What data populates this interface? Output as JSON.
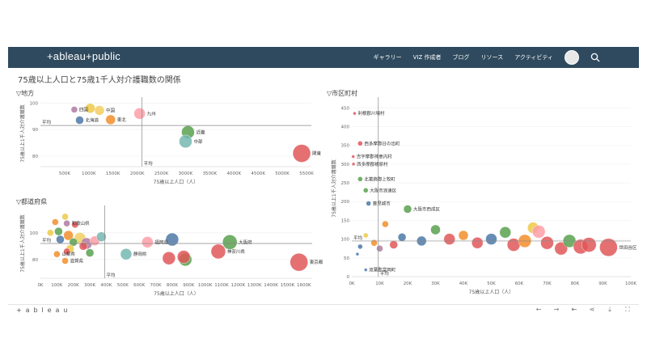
{
  "navbar": {
    "logo": "+ableau+public",
    "links": [
      "ギャラリー",
      "VIZ 作成者",
      "ブログ",
      "リソース",
      "アクティビティ"
    ]
  },
  "dashboard": {
    "title": "75歳以上人口と75歳1千人対介護職数の関係",
    "sheets": {
      "region": "▽地方",
      "prefecture": "▽都道府県",
      "municipality": "▽市区町村"
    }
  },
  "footer": {
    "logo": "+ a b l e a u",
    "controls": [
      "undo-icon",
      "redo-icon",
      "revert-icon",
      "share-icon",
      "download-icon",
      "fullscreen-icon"
    ]
  },
  "chart_data": [
    {
      "type": "scatter",
      "xlabel": "75歳以上人口（人）",
      "ylabel": "75歳以上1千人対介護職数",
      "xlim": [
        0,
        5600000
      ],
      "ylim": [
        76,
        101
      ],
      "xticks": [
        500000,
        1000000,
        1500000,
        2000000,
        2500000,
        3000000,
        3500000,
        4000000,
        4500000,
        5000000,
        5500000
      ],
      "xticklabels": [
        "500K",
        "1000K",
        "1500K",
        "2000K",
        "2500K",
        "3000K",
        "3500K",
        "4000K",
        "4500K",
        "5000K",
        "5500K"
      ],
      "yticks": [
        80,
        90,
        100
      ],
      "reference_lines": {
        "x": 2100000,
        "y": 91.5,
        "x_label": "平均",
        "y_label": "平均"
      },
      "points": [
        {
          "label": "四国",
          "x": 700000,
          "y": 97.5,
          "size": 4,
          "color": "#b07aa1"
        },
        {
          "label": "",
          "x": 1030000,
          "y": 98,
          "size": 6,
          "color": "#edc948"
        },
        {
          "label": "中国",
          "x": 1220000,
          "y": 97.2,
          "size": 6,
          "color": "#f1ce63"
        },
        {
          "label": "北海道",
          "x": 810000,
          "y": 93.5,
          "size": 5,
          "color": "#4e79a7"
        },
        {
          "label": "東北",
          "x": 1450000,
          "y": 93.7,
          "size": 6,
          "color": "#f28e2b"
        },
        {
          "label": "九州",
          "x": 2050000,
          "y": 96,
          "size": 7,
          "color": "#ff9da7"
        },
        {
          "label": "近畿",
          "x": 3050000,
          "y": 89,
          "size": 8,
          "color": "#59a14f"
        },
        {
          "label": "中部",
          "x": 3000000,
          "y": 85.5,
          "size": 8,
          "color": "#76b7b2"
        },
        {
          "label": "関東",
          "x": 5400000,
          "y": 81,
          "size": 11,
          "color": "#e15759"
        }
      ]
    },
    {
      "type": "scatter",
      "xlabel": "75歳以上人口（人）",
      "ylabel": "75歳以上1千人対介護職数",
      "xlim": [
        0,
        1650000
      ],
      "ylim": [
        66,
        118
      ],
      "xticks": [
        0,
        100000,
        200000,
        300000,
        400000,
        500000,
        600000,
        700000,
        800000,
        900000,
        1000000,
        1100000,
        1200000,
        1300000,
        1400000,
        1500000,
        1600000
      ],
      "xticklabels": [
        "0K",
        "100K",
        "200K",
        "300K",
        "400K",
        "500K",
        "600K",
        "700K",
        "800K",
        "900K",
        "1000K",
        "1100K",
        "1200K",
        "1300K",
        "1400K",
        "1500K",
        "1600K"
      ],
      "yticks": [
        80,
        100
      ],
      "reference_lines": {
        "x": 390000,
        "y": 92,
        "x_label": "平均",
        "y_label": "平均"
      },
      "points": [
        {
          "label": "",
          "x": 150000,
          "y": 112,
          "size": 4,
          "color": "#edc948"
        },
        {
          "label": "和歌山県",
          "x": 160000,
          "y": 107,
          "size": 4,
          "color": "#b07aa1"
        },
        {
          "label": "",
          "x": 210000,
          "y": 106,
          "size": 4,
          "color": "#e15759"
        },
        {
          "label": "",
          "x": 90000,
          "y": 108,
          "size": 4,
          "color": "#f28e2b"
        },
        {
          "label": "",
          "x": 60000,
          "y": 100,
          "size": 4,
          "color": "#edc948"
        },
        {
          "label": "",
          "x": 110000,
          "y": 101,
          "size": 5,
          "color": "#59a14f"
        },
        {
          "label": "",
          "x": 170000,
          "y": 98,
          "size": 6,
          "color": "#f28e2b"
        },
        {
          "label": "",
          "x": 240000,
          "y": 96,
          "size": 7,
          "color": "#f1ce63"
        },
        {
          "label": "",
          "x": 280000,
          "y": 92,
          "size": 7,
          "color": "#b07aa1"
        },
        {
          "label": "",
          "x": 330000,
          "y": 94,
          "size": 6,
          "color": "#ff9da7"
        },
        {
          "label": "",
          "x": 200000,
          "y": 93,
          "size": 5,
          "color": "#59a14f"
        },
        {
          "label": "",
          "x": 120000,
          "y": 95,
          "size": 5,
          "color": "#4e79a7"
        },
        {
          "label": "",
          "x": 260000,
          "y": 90,
          "size": 5,
          "color": "#e15759"
        },
        {
          "label": "",
          "x": 180000,
          "y": 88,
          "size": 5,
          "color": "#edc948"
        },
        {
          "label": "山梨県",
          "x": 100000,
          "y": 84,
          "size": 4,
          "color": "#f28e2b"
        },
        {
          "label": "",
          "x": 160000,
          "y": 86,
          "size": 4,
          "color": "#e15759"
        },
        {
          "label": "滋賀県",
          "x": 150000,
          "y": 79,
          "size": 4,
          "color": "#f28e2b"
        },
        {
          "label": "",
          "x": 300000,
          "y": 85,
          "size": 5,
          "color": "#59a14f"
        },
        {
          "label": "",
          "x": 370000,
          "y": 97,
          "size": 6,
          "color": "#76b7b2"
        },
        {
          "label": "福岡県",
          "x": 650000,
          "y": 93,
          "size": 7,
          "color": "#ff9da7"
        },
        {
          "label": "",
          "x": 800000,
          "y": 95,
          "size": 8,
          "color": "#4e79a7"
        },
        {
          "label": "静岡県",
          "x": 520000,
          "y": 84,
          "size": 7,
          "color": "#76b7b2"
        },
        {
          "label": "",
          "x": 780000,
          "y": 81,
          "size": 8,
          "color": "#e15759"
        },
        {
          "label": "",
          "x": 880000,
          "y": 80,
          "size": 8,
          "color": "#59a14f"
        },
        {
          "label": "",
          "x": 870000,
          "y": 82,
          "size": 8,
          "color": "#e15759"
        },
        {
          "label": "神奈川県",
          "x": 1080000,
          "y": 86,
          "size": 9,
          "color": "#e15759"
        },
        {
          "label": "大阪府",
          "x": 1150000,
          "y": 93,
          "size": 9,
          "color": "#59a14f"
        },
        {
          "label": "東京都",
          "x": 1570000,
          "y": 78,
          "size": 11,
          "color": "#e15759"
        }
      ]
    },
    {
      "type": "scatter",
      "xlabel": "75歳以上人口（人）",
      "ylabel": "75歳以上1千人対介護職数",
      "xlim": [
        0,
        100000
      ],
      "ylim": [
        0,
        470
      ],
      "xticks": [
        0,
        10000,
        20000,
        30000,
        40000,
        50000,
        60000,
        70000,
        80000,
        90000,
        100000
      ],
      "xticklabels": [
        "0K",
        "10K",
        "20K",
        "30K",
        "40K",
        "50K",
        "60K",
        "70K",
        "80K",
        "90K",
        "100K"
      ],
      "yticks": [
        0,
        50,
        100,
        150,
        200,
        250,
        300,
        350,
        400,
        450
      ],
      "reference_lines": {
        "x": 9500,
        "y": 95,
        "x_label": "平均",
        "y_label": "平均"
      },
      "points": [
        {
          "label": "利根郡川場村",
          "x": 1000,
          "y": 435,
          "size": 2,
          "color": "#e15759"
        },
        {
          "label": "西多摩郡日の出町",
          "x": 3000,
          "y": 355,
          "size": 3,
          "color": "#e15759"
        },
        {
          "label": "吉宇摩郡神恵内村",
          "x": 500,
          "y": 320,
          "size": 2,
          "color": "#e15759"
        },
        {
          "label": "西多摩郡檜原村",
          "x": 600,
          "y": 300,
          "size": 2,
          "color": "#e15759"
        },
        {
          "label": "北葛飾郡上牧町",
          "x": 3000,
          "y": 260,
          "size": 3,
          "color": "#59a14f"
        },
        {
          "label": "大阪市浪速区",
          "x": 5000,
          "y": 230,
          "size": 3,
          "color": "#59a14f"
        },
        {
          "label": "大阪市西成区",
          "x": 20000,
          "y": 180,
          "size": 5,
          "color": "#59a14f"
        },
        {
          "label": "豊見城市",
          "x": 6000,
          "y": 195,
          "size": 3,
          "color": "#4e79a7"
        },
        {
          "label": "",
          "x": 12000,
          "y": 140,
          "size": 4,
          "color": "#f28e2b"
        },
        {
          "label": "",
          "x": 30000,
          "y": 125,
          "size": 6,
          "color": "#59a14f"
        },
        {
          "label": "",
          "x": 40000,
          "y": 110,
          "size": 6,
          "color": "#f28e2b"
        },
        {
          "label": "",
          "x": 55000,
          "y": 118,
          "size": 7,
          "color": "#59a14f"
        },
        {
          "label": "",
          "x": 65000,
          "y": 130,
          "size": 7,
          "color": "#edc948"
        },
        {
          "label": "",
          "x": 67000,
          "y": 120,
          "size": 8,
          "color": "#ff9da7"
        },
        {
          "label": "",
          "x": 18000,
          "y": 105,
          "size": 5,
          "color": "#4e79a7"
        },
        {
          "label": "",
          "x": 25000,
          "y": 95,
          "size": 6,
          "color": "#4e79a7"
        },
        {
          "label": "",
          "x": 35000,
          "y": 100,
          "size": 7,
          "color": "#e15759"
        },
        {
          "label": "",
          "x": 45000,
          "y": 90,
          "size": 7,
          "color": "#e15759"
        },
        {
          "label": "",
          "x": 50000,
          "y": 100,
          "size": 7,
          "color": "#4e79a7"
        },
        {
          "label": "",
          "x": 58000,
          "y": 85,
          "size": 8,
          "color": "#e15759"
        },
        {
          "label": "",
          "x": 62000,
          "y": 95,
          "size": 8,
          "color": "#f28e2b"
        },
        {
          "label": "",
          "x": 70000,
          "y": 90,
          "size": 8,
          "color": "#e15759"
        },
        {
          "label": "",
          "x": 75000,
          "y": 75,
          "size": 8,
          "color": "#e15759"
        },
        {
          "label": "",
          "x": 78000,
          "y": 95,
          "size": 8,
          "color": "#59a14f"
        },
        {
          "label": "",
          "x": 82000,
          "y": 80,
          "size": 9,
          "color": "#e15759"
        },
        {
          "label": "",
          "x": 85000,
          "y": 85,
          "size": 9,
          "color": "#e15759"
        },
        {
          "label": "",
          "x": 8000,
          "y": 90,
          "size": 4,
          "color": "#f28e2b"
        },
        {
          "label": "",
          "x": 10000,
          "y": 75,
          "size": 4,
          "color": "#b07aa1"
        },
        {
          "label": "",
          "x": 15000,
          "y": 85,
          "size": 5,
          "color": "#e15759"
        },
        {
          "label": "",
          "x": 5000,
          "y": 110,
          "size": 3,
          "color": "#edc948"
        },
        {
          "label": "",
          "x": 3000,
          "y": 80,
          "size": 3,
          "color": "#4e79a7"
        },
        {
          "label": "",
          "x": 2000,
          "y": 60,
          "size": 2,
          "color": "#4e79a7"
        },
        {
          "label": "双葉郡富岡町",
          "x": 5000,
          "y": 18,
          "size": 2,
          "color": "#4e79a7"
        },
        {
          "label": "世田谷区",
          "x": 92000,
          "y": 78,
          "size": 11,
          "color": "#e15759"
        }
      ]
    }
  ]
}
